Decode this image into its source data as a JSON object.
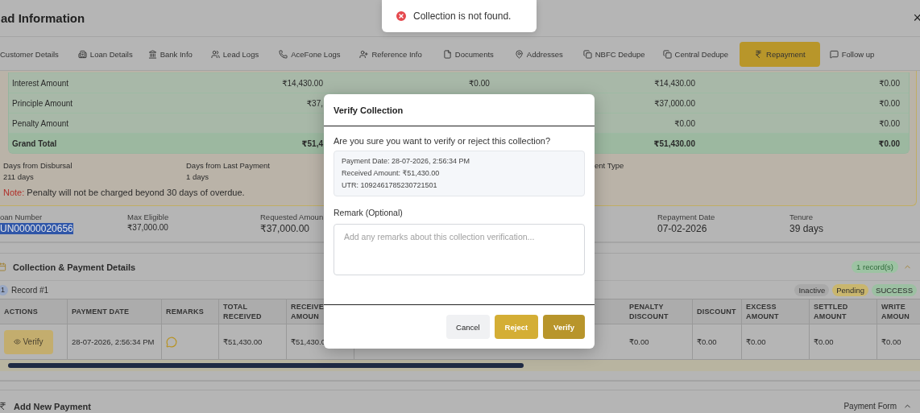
{
  "header": {
    "title": "ad Information",
    "close": "×"
  },
  "toast": {
    "kind": "error",
    "message": "Collection is not found."
  },
  "tabs": [
    {
      "label": "Customer Details",
      "selected": false
    },
    {
      "label": "Loan Details",
      "selected": false
    },
    {
      "label": "Bank Info",
      "selected": false
    },
    {
      "label": "Lead Logs",
      "selected": false
    },
    {
      "label": "AceFone Logs",
      "selected": false
    },
    {
      "label": "Reference Info",
      "selected": false
    },
    {
      "label": "Documents",
      "selected": false
    },
    {
      "label": "Addresses",
      "selected": false
    },
    {
      "label": "NBFC Dedupe",
      "selected": false
    },
    {
      "label": "Central Dedupe",
      "selected": false
    },
    {
      "label": "Repayment",
      "selected": true
    },
    {
      "label": "Follow up",
      "selected": false
    }
  ],
  "summary": {
    "rows": [
      {
        "label": "Interest Amount",
        "kind": "normal",
        "cells": [
          "₹14,430.00",
          "₹0.00",
          "₹14,430.00",
          "₹0.00"
        ]
      },
      {
        "label": "Principle Amount",
        "kind": "normal",
        "cells": [
          "₹37,",
          null,
          "₹37,000.00",
          "₹0.00"
        ]
      },
      {
        "label": "Penalty Amount",
        "kind": "normal",
        "cells": [
          null,
          null,
          "₹0.00",
          "₹0.00"
        ]
      },
      {
        "label": "Grand Total",
        "kind": "total",
        "cells": [
          "₹51,4",
          null,
          "₹51,430.00",
          "₹0.00"
        ]
      }
    ],
    "stats": [
      {
        "label": "Days from Disbursal",
        "value": "211 days"
      },
      {
        "label": "Days from Last Payment",
        "value": "1 days"
      },
      {
        "label": "ent Type"
      }
    ],
    "note": {
      "label": "Note:",
      "text": "Penalty will not be charged beyond 30 days of overdue."
    }
  },
  "loan_fields": [
    {
      "label": "oan Number",
      "value": "UN00000020656",
      "highlighted": true
    },
    {
      "label": "Max Eligible",
      "value": "₹37,000.00",
      "highlighted": false
    },
    {
      "label": "Requested Amoun",
      "value": "₹37,000.00",
      "highlighted": false
    },
    {
      "label": "Repayment Date",
      "value": "07-02-2026",
      "highlighted": false
    },
    {
      "label": "Tenure",
      "value": "39 days",
      "highlighted": false
    }
  ],
  "collection": {
    "title": "Collection & Payment Details",
    "badge": "1 record(s)",
    "expanded": true,
    "record": {
      "number": "1",
      "title": "Record #1"
    },
    "statuses": [
      {
        "label": "Inactive",
        "color": "#a9a9a9"
      },
      {
        "label": "Pending",
        "color": "#c9b66e"
      },
      {
        "label": "SUCCESS",
        "color": "#9cc0a2"
      }
    ],
    "columns": [
      "ACTIONS",
      "PAYMENT DATE",
      "REMARKS",
      "TOTAL RECEIVED",
      "RECEIVE AMOUN",
      "PENALTY DISCOUNT",
      "DISCOUNT",
      "EXCESS AMOUNT",
      "SETTLED AMOUNT",
      "WRITE AMOUN"
    ],
    "rows": [
      {
        "cells": [
          {
            "kind": "button",
            "text": "Verify"
          },
          {
            "kind": "text",
            "text": "28-07-2026, 2:56:34 PM"
          },
          {
            "kind": "remark"
          },
          {
            "kind": "text",
            "text": "₹51,430.00"
          },
          {
            "kind": "text",
            "text": "₹51,430.0"
          },
          {
            "kind": "text",
            "text": "₹0.00"
          },
          {
            "kind": "text",
            "text": "₹0.00"
          },
          {
            "kind": "text",
            "text": "₹0.00"
          },
          {
            "kind": "text",
            "text": "₹0.00"
          },
          {
            "kind": "text",
            "text": "₹0.00"
          }
        ]
      }
    ]
  },
  "add_payment": {
    "title": "Add New Payment",
    "action": "Payment Form",
    "expanded": true
  },
  "modal": {
    "title": "Verify Collection",
    "question": "Are you sure you want to verify or reject this collection?",
    "details": [
      "Payment Date: 28-07-2026, 2:56:34 PM",
      "Received Amount: ₹51,430.00",
      "UTR: 1092461785230721501"
    ],
    "remark_label": "Remark (Optional)",
    "placeholder": "Add any remarks about this collection verification...",
    "buttons": [
      {
        "label": "Cancel",
        "kind": "cancel"
      },
      {
        "label": "Reject",
        "kind": "reject"
      },
      {
        "label": "Verify",
        "kind": "verify"
      }
    ]
  }
}
